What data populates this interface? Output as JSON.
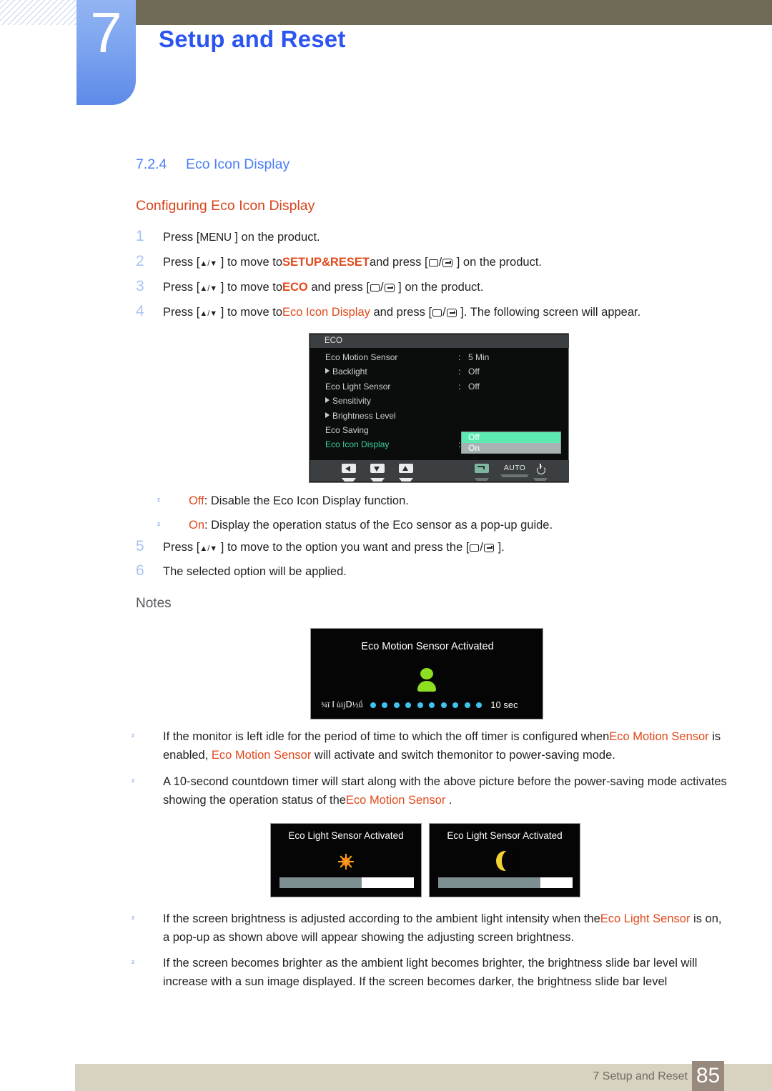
{
  "header": {
    "chapter_number": "7",
    "chapter_title": "Setup and Reset"
  },
  "section": {
    "number": "7.2.4",
    "title": "Eco Icon Display",
    "subtitle": "Configuring Eco Icon Display"
  },
  "steps": [
    {
      "n": "1",
      "parts": [
        {
          "t": "Press [",
          "c": "plain"
        },
        {
          "t": "MENU",
          "c": "key"
        },
        {
          "t": " ] on the product.",
          "c": "plain"
        }
      ]
    },
    {
      "n": "2",
      "parts": [
        {
          "t": "Press [",
          "c": "plain"
        },
        {
          "t": "ARROWS",
          "c": "arrows"
        },
        {
          "t": " ] to move to",
          "c": "plain"
        },
        {
          "t": "SETUP&RESET",
          "c": "kwb"
        },
        {
          "t": "and press [",
          "c": "plain"
        },
        {
          "t": "RECTENTER",
          "c": "glyphs"
        },
        {
          "t": " ] on the product.",
          "c": "plain"
        }
      ]
    },
    {
      "n": "3",
      "parts": [
        {
          "t": "Press [",
          "c": "plain"
        },
        {
          "t": "ARROWS",
          "c": "arrows"
        },
        {
          "t": " ] to move to",
          "c": "plain"
        },
        {
          "t": "ECO",
          "c": "kwb"
        },
        {
          "t": " and press [",
          "c": "plain"
        },
        {
          "t": "RECTENTER",
          "c": "glyphs"
        },
        {
          "t": " ] on the product.",
          "c": "plain"
        }
      ]
    },
    {
      "n": "4",
      "parts": [
        {
          "t": "Press [",
          "c": "plain"
        },
        {
          "t": "ARROWS",
          "c": "arrows"
        },
        {
          "t": " ] to move to",
          "c": "plain"
        },
        {
          "t": "Eco Icon Display",
          "c": "kw"
        },
        {
          "t": " and press [",
          "c": "plain"
        },
        {
          "t": "RECTENTER",
          "c": "glyphs"
        },
        {
          "t": " ]. The following screen will appear.",
          "c": "plain"
        }
      ]
    },
    {
      "n": "5",
      "parts": [
        {
          "t": "Press [",
          "c": "plain"
        },
        {
          "t": "ARROWS",
          "c": "arrows"
        },
        {
          "t": " ] to move to the option you want and press the [",
          "c": "plain"
        },
        {
          "t": "RECTENTER",
          "c": "glyphs"
        },
        {
          "t": " ].",
          "c": "plain"
        }
      ]
    },
    {
      "n": "6",
      "parts": [
        {
          "t": "The selected option will be applied.",
          "c": "plain"
        }
      ]
    }
  ],
  "option_bullets": [
    {
      "kw": "Off",
      "rest": ": Disable the Eco Icon Display function."
    },
    {
      "kw": "On",
      "rest": ": Display the operation status of the Eco sensor as a pop-up guide."
    }
  ],
  "notes_label": "Notes",
  "osd": {
    "title": "ECO",
    "rows": [
      {
        "label": "Eco Motion Sensor",
        "arrow": false,
        "colon": ":",
        "value": "5 Min",
        "green": false
      },
      {
        "label": "Backlight",
        "arrow": true,
        "colon": ":",
        "value": "Off",
        "green": false
      },
      {
        "label": "Eco Light Sensor",
        "arrow": false,
        "colon": ":",
        "value": "Off",
        "green": false
      },
      {
        "label": "Sensitivity",
        "arrow": true,
        "colon": "",
        "value": "",
        "green": false
      },
      {
        "label": "Brightness Level",
        "arrow": true,
        "colon": "",
        "value": "",
        "green": false
      },
      {
        "label": "Eco Saving",
        "arrow": false,
        "colon": "",
        "value": "",
        "green": false
      },
      {
        "label": "Eco Icon Display",
        "arrow": false,
        "colon": ":",
        "value": "",
        "green": true
      }
    ],
    "popup_options": [
      {
        "label": "Off",
        "selected": true
      },
      {
        "label": "On",
        "selected": false
      }
    ],
    "buttons": [
      {
        "name": "left-arrow-button",
        "glyph": "left"
      },
      {
        "name": "down-arrow-button",
        "glyph": "down"
      },
      {
        "name": "up-arrow-button",
        "glyph": "up"
      },
      {
        "name": "enter-button",
        "glyph": "enter"
      },
      {
        "name": "auto-button",
        "glyph": "auto",
        "label": "AUTO"
      },
      {
        "name": "power-button",
        "glyph": "power"
      }
    ],
    "colors": {
      "selected_highlight": "#5ceab2",
      "unselected_highlight": "#a9b2b2",
      "active_label": "#3ad39a"
    }
  },
  "motion_popup": {
    "title": "Eco Motion Sensor Activated",
    "countdown_text": "¾ī Ⅰ ùijⅮ½ǘ",
    "seconds_label": "10 sec",
    "dot_count": 10,
    "icon": "person-icon",
    "icon_color": "#8ede22",
    "dot_color": "#3fc4f0"
  },
  "light_popups": [
    {
      "title": "Eco Light Sensor Activated",
      "icon": "sun-icon",
      "icon_color": "#f24f12",
      "slider_fill_percent": 61
    },
    {
      "title": "Eco Light Sensor Activated",
      "icon": "moon-icon",
      "icon_color": "#f2d134",
      "slider_fill_percent": 76
    }
  ],
  "note_bullets": [
    {
      "parts": [
        {
          "t": "If the monitor is left idle for the period of time to which the off timer is configured when",
          "c": "plain"
        },
        {
          "t": "Eco Motion Sensor",
          "c": "kw"
        },
        {
          "t": " is enabled, ",
          "c": "plain"
        },
        {
          "t": "Eco Motion Sensor",
          "c": "kw"
        },
        {
          "t": "  will activate and switch the",
          "c": "plain"
        },
        {
          "t": "monitor to power-saving mode.",
          "c": "plain"
        }
      ]
    },
    {
      "parts": [
        {
          "t": "A 10-second countdown timer will start along with the above picture before the power-saving mode activates showing the operation status of the",
          "c": "plain"
        },
        {
          "t": "Eco Motion Sensor",
          "c": "kw"
        },
        {
          "t": " .",
          "c": "plain"
        }
      ]
    }
  ],
  "note_bullets2": [
    {
      "parts": [
        {
          "t": "If the screen brightness is adjusted according to the ambient light intensity when the",
          "c": "plain"
        },
        {
          "t": "Eco Light Sensor",
          "c": "kw"
        },
        {
          "t": " is on, a pop-up as shown above will appear showing the adjusting screen brightness.",
          "c": "plain"
        }
      ]
    },
    {
      "parts": [
        {
          "t": "If the screen becomes brighter as the ambient light becomes brighter, the brightness slide bar level will increase with a sun image displayed. If the screen becomes darker, the brightness slide bar level",
          "c": "plain"
        }
      ]
    }
  ],
  "footer": {
    "text": "7 Setup and Reset",
    "page": "85"
  }
}
